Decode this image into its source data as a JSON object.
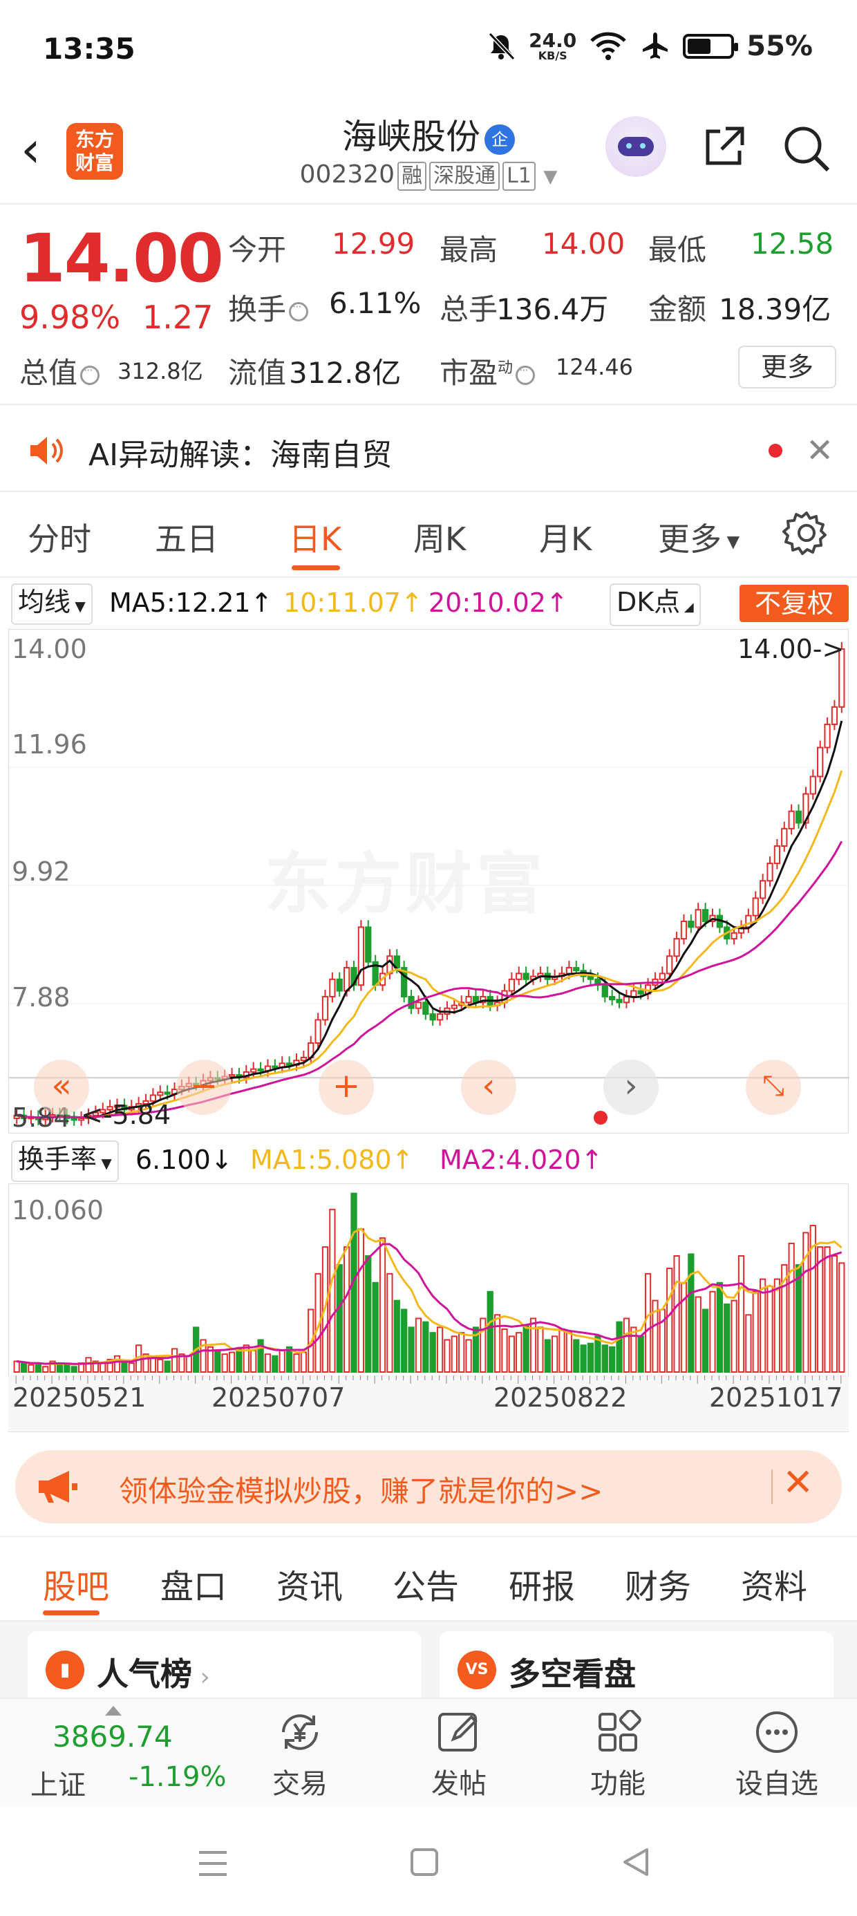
{
  "status_bar": {
    "time": "13:35",
    "net_speed": "24.0",
    "net_unit": "KB/S",
    "battery": "55%",
    "battery_level": 0.55
  },
  "header": {
    "app_logo": "东方\n财富",
    "stock_name": "海峡股份",
    "badge": "企",
    "stock_code": "002320",
    "tags": [
      "融",
      "深股通",
      "L1"
    ]
  },
  "quote": {
    "price": "14.00",
    "pct_change": "9.98%",
    "change": "1.27",
    "open_label": "今开",
    "open": "12.99",
    "high_label": "最高",
    "high": "14.00",
    "low_label": "最低",
    "low": "12.58",
    "turnover_label": "换手",
    "turnover": "6.11%",
    "volume_label": "总手",
    "volume": "136.4万",
    "amount_label": "金额",
    "amount": "18.39亿",
    "mktcap_label": "总值",
    "mktcap": "312.8亿",
    "float_label": "流值",
    "float_cap": "312.8亿",
    "pe_label": "市盈",
    "pe_sup": "动",
    "pe": "124.46",
    "more_label": "更多"
  },
  "ai_bar": {
    "text": "AI异动解读：海南自贸"
  },
  "chart_tabs": [
    "分时",
    "五日",
    "日K",
    "周K",
    "月K",
    "更多"
  ],
  "active_tab": "日K",
  "ma_bar": {
    "selector": "均线",
    "ma5": "MA5:12.21",
    "ma10": "10:11.07",
    "ma20": "20:10.02",
    "dk": "DK点",
    "adjust": "不复权"
  },
  "vol_bar": {
    "selector": "换手率",
    "value": "6.100",
    "ma1": "MA1:5.080",
    "ma2": "MA2:4.020"
  },
  "colors": {
    "up": "#e02c2c",
    "down": "#1d9e2f",
    "ma5": "#111111",
    "ma10": "#f2b81c",
    "ma20": "#d0149a",
    "accent": "#f25a1e"
  },
  "chart_data": {
    "type": "candlestick",
    "y_ticks": [
      "14.00",
      "11.96",
      "9.92",
      "7.88",
      "5.84"
    ],
    "ylim": [
      5.84,
      14.0
    ],
    "last_price_label": "14.00->",
    "low_label": "<-5.84",
    "watermark": "东方财富",
    "x_labels": [
      "20250521",
      "20250707",
      "20250822",
      "20251017"
    ],
    "close": [
      5.95,
      5.9,
      5.92,
      5.88,
      5.93,
      5.96,
      5.95,
      5.9,
      5.87,
      5.9,
      5.95,
      6.0,
      6.05,
      6.1,
      6.12,
      6.05,
      6.1,
      6.15,
      6.2,
      6.3,
      6.35,
      6.32,
      6.4,
      6.45,
      6.5,
      6.48,
      6.55,
      6.6,
      6.58,
      6.62,
      6.65,
      6.6,
      6.7,
      6.75,
      6.72,
      6.8,
      6.78,
      6.85,
      6.82,
      6.9,
      6.95,
      7.2,
      7.6,
      8.0,
      8.3,
      8.1,
      8.5,
      8.2,
      9.2,
      8.6,
      8.2,
      8.4,
      8.7,
      8.5,
      8.0,
      7.8,
      7.9,
      7.7,
      7.6,
      7.7,
      7.8,
      7.85,
      7.9,
      8.0,
      7.9,
      8.0,
      7.85,
      7.9,
      8.1,
      8.3,
      8.4,
      8.3,
      8.35,
      8.4,
      8.3,
      8.35,
      8.4,
      8.5,
      8.45,
      8.35,
      8.3,
      8.2,
      8.0,
      7.95,
      7.9,
      8.0,
      8.1,
      8.05,
      8.2,
      8.3,
      8.4,
      8.7,
      9.0,
      9.3,
      9.2,
      9.5,
      9.3,
      9.4,
      9.2,
      9.0,
      9.1,
      9.2,
      9.4,
      9.7,
      10.0,
      10.3,
      10.6,
      10.9,
      11.2,
      11.0,
      11.5,
      11.8,
      12.3,
      12.7,
      13.0,
      14.0
    ],
    "turnover_ylim": [
      0,
      10.06
    ],
    "turnover_max_label": "10.060",
    "turnover": [
      0.6,
      0.5,
      0.4,
      0.5,
      0.3,
      0.6,
      0.5,
      0.4,
      0.3,
      0.5,
      0.8,
      0.6,
      0.5,
      0.7,
      0.9,
      0.6,
      0.5,
      1.5,
      1.0,
      0.8,
      0.7,
      0.6,
      1.3,
      1.0,
      0.9,
      2.5,
      1.8,
      1.4,
      1.2,
      1.0,
      1.1,
      1.3,
      1.5,
      1.2,
      1.8,
      1.0,
      0.9,
      1.2,
      1.4,
      1.0,
      1.1,
      3.5,
      5.5,
      7.0,
      9.1,
      6.0,
      7.0,
      10.0,
      8.0,
      6.5,
      5.0,
      7.5,
      5.5,
      4.0,
      3.5,
      2.5,
      3.0,
      2.8,
      2.2,
      2.5,
      1.8,
      2.0,
      2.2,
      1.8,
      2.5,
      3.0,
      4.5,
      3.2,
      2.4,
      2.0,
      2.2,
      2.6,
      3.0,
      2.5,
      1.8,
      2.0,
      2.4,
      2.2,
      1.8,
      1.5,
      1.6,
      2.0,
      1.5,
      1.4,
      2.8,
      3.0,
      2.5,
      2.0,
      5.5,
      4.0,
      3.5,
      5.8,
      6.5,
      5.0,
      6.6,
      4.2,
      3.5,
      4.5,
      5.0,
      3.8,
      4.0,
      6.5,
      3.2,
      4.5,
      5.2,
      4.8,
      5.2,
      6.0,
      7.2,
      6.0,
      7.8,
      8.2,
      7.0,
      7.0,
      6.5,
      6.1
    ]
  },
  "promo": {
    "text": "领体验金模拟炒股，赚了就是你的>>"
  },
  "bottom_tabs": [
    "股吧",
    "盘口",
    "资讯",
    "公告",
    "研报",
    "财务",
    "资料"
  ],
  "cards": [
    {
      "title": "人气榜",
      "icon": "bar-chart-icon"
    },
    {
      "title": "多空看盘",
      "icon": "vs-icon"
    }
  ],
  "index": {
    "value": "3869.74",
    "name": "上证",
    "change": "-1.19%"
  },
  "nav": [
    {
      "label": "交易",
      "icon": "yen-cycle-icon"
    },
    {
      "label": "发帖",
      "icon": "edit-icon"
    },
    {
      "label": "功能",
      "icon": "grid-icon"
    },
    {
      "label": "设自选",
      "icon": "more-dots-icon"
    }
  ]
}
